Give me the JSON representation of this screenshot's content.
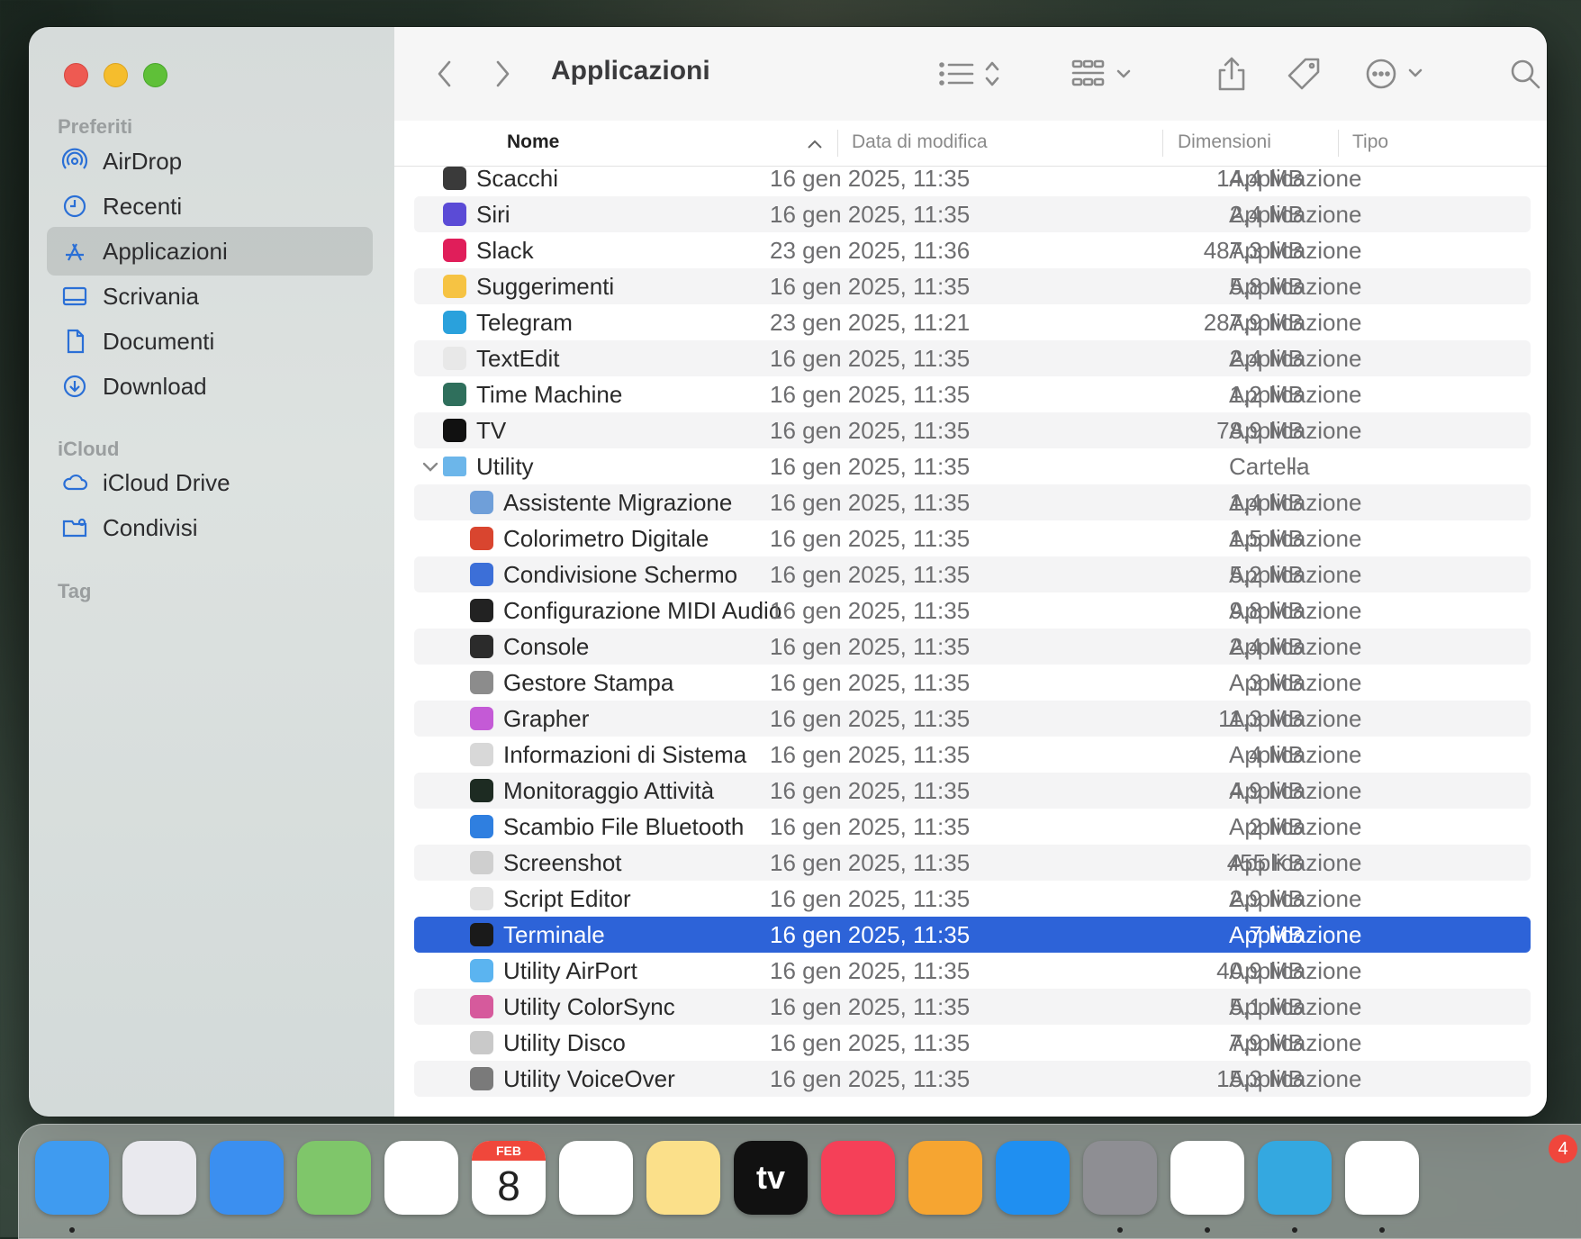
{
  "window": {
    "title": "Applicazioni"
  },
  "sidebar": {
    "sections": [
      {
        "label": "Preferiti"
      },
      {
        "label": "iCloud"
      },
      {
        "label": "Tag"
      }
    ],
    "favorites": [
      {
        "label": "AirDrop",
        "icon": "airdrop-icon"
      },
      {
        "label": "Recenti",
        "icon": "clock-icon"
      },
      {
        "label": "Applicazioni",
        "icon": "applications-icon",
        "active": true
      },
      {
        "label": "Scrivania",
        "icon": "desktop-icon"
      },
      {
        "label": "Documenti",
        "icon": "document-icon"
      },
      {
        "label": "Download",
        "icon": "download-icon"
      }
    ],
    "icloud": [
      {
        "label": "iCloud Drive",
        "icon": "cloud-icon"
      },
      {
        "label": "Condivisi",
        "icon": "shared-folder-icon"
      }
    ]
  },
  "columns": {
    "name": "Nome",
    "date": "Data di modifica",
    "size": "Dimensioni",
    "kind": "Tipo"
  },
  "rows": [
    {
      "name": "Scacchi",
      "date": "16 gen 2025, 11:35",
      "size": "14,4 MB",
      "kind": "Applicazione",
      "icon": "chess-icon",
      "color": "#3a3a3a"
    },
    {
      "name": "Siri",
      "date": "16 gen 2025, 11:35",
      "size": "2,4 MB",
      "kind": "Applicazione",
      "icon": "siri-icon",
      "color": "#5b4bd6"
    },
    {
      "name": "Slack",
      "date": "23 gen 2025, 11:36",
      "size": "487,3 MB",
      "kind": "Applicazione",
      "icon": "slack-icon",
      "color": "#e01e5a"
    },
    {
      "name": "Suggerimenti",
      "date": "16 gen 2025, 11:35",
      "size": "5,8 MB",
      "kind": "Applicazione",
      "icon": "tips-icon",
      "color": "#f6c343"
    },
    {
      "name": "Telegram",
      "date": "23 gen 2025, 11:21",
      "size": "287,9 MB",
      "kind": "Applicazione",
      "icon": "telegram-icon",
      "color": "#2aa1dc"
    },
    {
      "name": "TextEdit",
      "date": "16 gen 2025, 11:35",
      "size": "2,4 MB",
      "kind": "Applicazione",
      "icon": "textedit-icon",
      "color": "#e8e8e8"
    },
    {
      "name": "Time Machine",
      "date": "16 gen 2025, 11:35",
      "size": "1,2 MB",
      "kind": "Applicazione",
      "icon": "time-machine-icon",
      "color": "#2f6f5c"
    },
    {
      "name": "TV",
      "date": "16 gen 2025, 11:35",
      "size": "78,9 MB",
      "kind": "Applicazione",
      "icon": "tv-icon",
      "color": "#111111"
    },
    {
      "name": "Utility",
      "date": "16 gen 2025, 11:35",
      "size": "--",
      "kind": "Cartella",
      "icon": "folder-icon",
      "color": "#6cb6ea",
      "folder": true
    },
    {
      "name": "Assistente Migrazione",
      "date": "16 gen 2025, 11:35",
      "size": "1,4 MB",
      "kind": "Applicazione",
      "icon": "migration-icon",
      "color": "#6f9fd9",
      "indent": true
    },
    {
      "name": "Colorimetro Digitale",
      "date": "16 gen 2025, 11:35",
      "size": "1,5 MB",
      "kind": "Applicazione",
      "icon": "colorimeter-icon",
      "color": "#d9452f",
      "indent": true
    },
    {
      "name": "Condivisione Schermo",
      "date": "16 gen 2025, 11:35",
      "size": "5,2 MB",
      "kind": "Applicazione",
      "icon": "screen-sharing-icon",
      "color": "#3c6fd8",
      "indent": true
    },
    {
      "name": "Configurazione MIDI Audio",
      "date": "16 gen 2025, 11:35",
      "size": "9,8 MB",
      "kind": "Applicazione",
      "icon": "midi-icon",
      "color": "#222222",
      "indent": true
    },
    {
      "name": "Console",
      "date": "16 gen 2025, 11:35",
      "size": "2,4 MB",
      "kind": "Applicazione",
      "icon": "console-icon",
      "color": "#2b2b2b",
      "indent": true
    },
    {
      "name": "Gestore Stampa",
      "date": "16 gen 2025, 11:35",
      "size": "3 MB",
      "kind": "Applicazione",
      "icon": "printer-icon",
      "color": "#8c8c8c",
      "indent": true
    },
    {
      "name": "Grapher",
      "date": "16 gen 2025, 11:35",
      "size": "11,3 MB",
      "kind": "Applicazione",
      "icon": "grapher-icon",
      "color": "#c45ad6",
      "indent": true
    },
    {
      "name": "Informazioni di Sistema",
      "date": "16 gen 2025, 11:35",
      "size": "4 MB",
      "kind": "Applicazione",
      "icon": "system-info-icon",
      "color": "#d8d8d8",
      "indent": true
    },
    {
      "name": "Monitoraggio Attività",
      "date": "16 gen 2025, 11:35",
      "size": "4,9 MB",
      "kind": "Applicazione",
      "icon": "activity-monitor-icon",
      "color": "#1d2b22",
      "indent": true
    },
    {
      "name": "Scambio File Bluetooth",
      "date": "16 gen 2025, 11:35",
      "size": "2 MB",
      "kind": "Applicazione",
      "icon": "bluetooth-icon",
      "color": "#2f7fe0",
      "indent": true
    },
    {
      "name": "Screenshot",
      "date": "16 gen 2025, 11:35",
      "size": "455 KB",
      "kind": "Applicazione",
      "icon": "screenshot-icon",
      "color": "#cfcfcf",
      "indent": true
    },
    {
      "name": "Script Editor",
      "date": "16 gen 2025, 11:35",
      "size": "2,9 MB",
      "kind": "Applicazione",
      "icon": "script-editor-icon",
      "color": "#e2e2e2",
      "indent": true
    },
    {
      "name": "Terminale",
      "date": "16 gen 2025, 11:35",
      "size": "7 MB",
      "kind": "Applicazione",
      "icon": "terminal-icon",
      "color": "#1a1a1a",
      "indent": true,
      "selected": true
    },
    {
      "name": "Utility AirPort",
      "date": "16 gen 2025, 11:35",
      "size": "40,9 MB",
      "kind": "Applicazione",
      "icon": "airport-icon",
      "color": "#5bb4f0",
      "indent": true
    },
    {
      "name": "Utility ColorSync",
      "date": "16 gen 2025, 11:35",
      "size": "5,1 MB",
      "kind": "Applicazione",
      "icon": "colorsync-icon",
      "color": "#d65a9c",
      "indent": true
    },
    {
      "name": "Utility Disco",
      "date": "16 gen 2025, 11:35",
      "size": "7,9 MB",
      "kind": "Applicazione",
      "icon": "disk-utility-icon",
      "color": "#c9c9c9",
      "indent": true
    },
    {
      "name": "Utility VoiceOver",
      "date": "16 gen 2025, 11:35",
      "size": "15,3 MB",
      "kind": "Applicazione",
      "icon": "voiceover-icon",
      "color": "#7a7a7a",
      "indent": true
    }
  ],
  "dock": {
    "apps": [
      {
        "name": "finder-icon",
        "color": "#3f9bf0",
        "running": true
      },
      {
        "name": "launchpad-icon",
        "color": "#e9e9ee"
      },
      {
        "name": "mail-icon",
        "color": "#3b8ff0"
      },
      {
        "name": "maps-icon",
        "color": "#7fc66a"
      },
      {
        "name": "photos-icon",
        "color": "#ffffff"
      },
      {
        "name": "calendar-icon",
        "color": "#ffffff",
        "month": "FEB",
        "day": "8"
      },
      {
        "name": "reminders-icon",
        "color": "#ffffff"
      },
      {
        "name": "notes-icon",
        "color": "#fbe08a"
      },
      {
        "name": "apple-tv-icon",
        "color": "#111111",
        "label": "tv"
      },
      {
        "name": "music-icon",
        "color": "#f54058"
      },
      {
        "name": "pages-icon",
        "color": "#f6a531"
      },
      {
        "name": "app-store-icon",
        "color": "#1f8ff1"
      },
      {
        "name": "system-settings-icon",
        "color": "#8e8e93",
        "running": true
      },
      {
        "name": "chrome-icon",
        "color": "#ffffff",
        "running": true
      },
      {
        "name": "telegram-dock-icon",
        "color": "#34a8e0",
        "running": true
      },
      {
        "name": "slack-dock-icon",
        "color": "#ffffff",
        "running": true
      }
    ],
    "slack_badge": "4"
  }
}
